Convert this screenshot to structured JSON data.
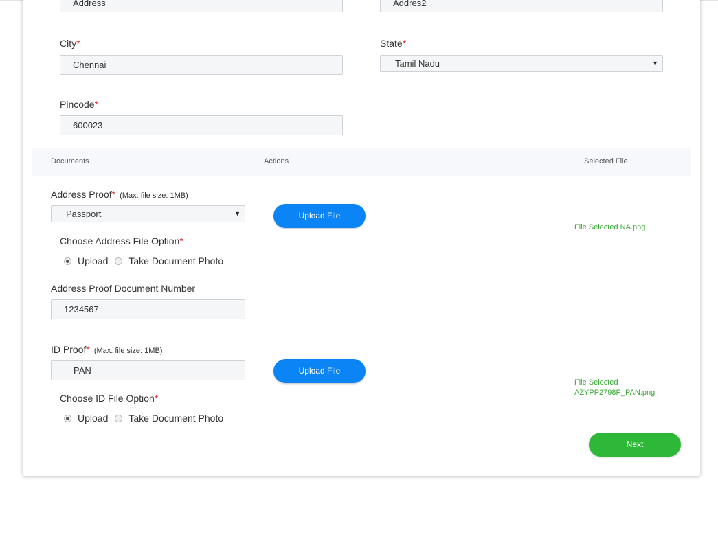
{
  "address": {
    "address1_value": "Address",
    "address2_value": "Addres2"
  },
  "city": {
    "label": "City",
    "required": "*",
    "value": "Chennai"
  },
  "state": {
    "label": "State",
    "required": "*",
    "value": "Tamil Nadu"
  },
  "pincode": {
    "label": "Pincode",
    "required": "*",
    "value": "600023"
  },
  "documents_table": {
    "col_documents": "Documents",
    "col_actions": "Actions",
    "col_selected_file": "Selected File"
  },
  "address_proof": {
    "label": "Address Proof",
    "required": "*",
    "note": "(Max. file size: 1MB)",
    "type_value": "Passport",
    "upload_button": "Upload File",
    "file_option_label": "Choose Address File Option",
    "file_option_required": "*",
    "option_upload": "Upload",
    "option_photo": "Take Document Photo",
    "selected_option": "Upload",
    "selected_file": "File Selected NA.png",
    "doc_number_label": "Address Proof Document Number",
    "doc_number_value": "1234567"
  },
  "id_proof": {
    "label": "ID Proof",
    "required": "*",
    "note": "(Max. file size: 1MB)",
    "type_value": "PAN",
    "upload_button": "Upload File",
    "file_option_label": "Choose ID File Option",
    "file_option_required": "*",
    "option_upload": "Upload",
    "option_photo": "Take Document Photo",
    "selected_option": "Upload",
    "selected_file_line1": "File Selected",
    "selected_file_line2": "AZYPP2798P_PAN.png"
  },
  "next_button": "Next",
  "icons": {
    "dropdown": "caret-down-icon",
    "radio": "radio-icon"
  },
  "colors": {
    "primary": "#0b84f6",
    "success": "#2db838",
    "required": "#e0313a",
    "file_text": "#3aa836"
  }
}
